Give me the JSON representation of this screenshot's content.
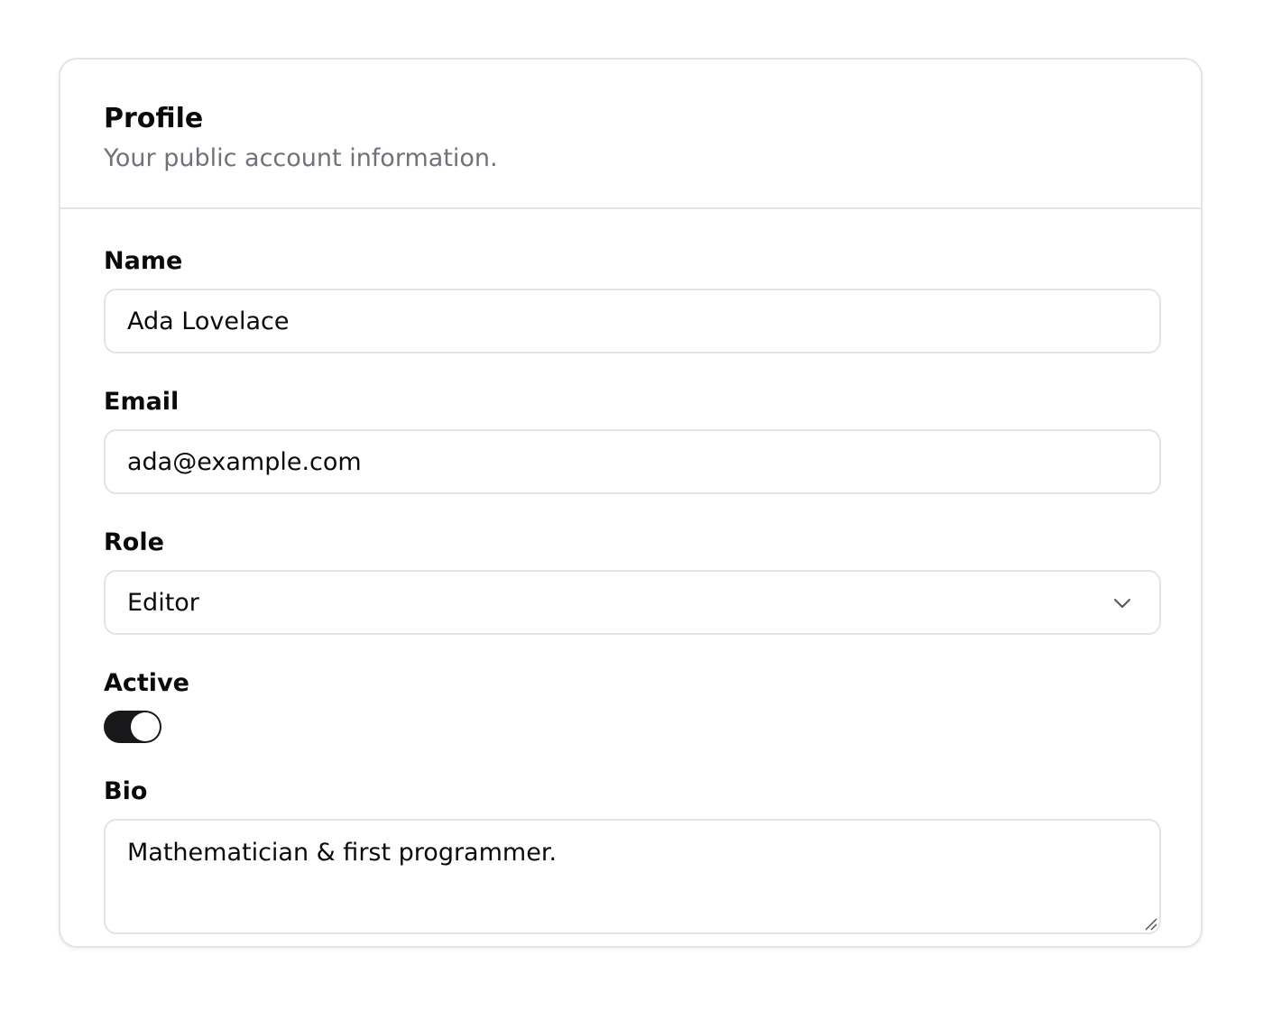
{
  "profile": {
    "title": "Profile",
    "subtitle": "Your public account information."
  },
  "fields": {
    "name": {
      "label": "Name",
      "value": "Ada Lovelace"
    },
    "email": {
      "label": "Email",
      "value": "ada@example.com"
    },
    "role": {
      "label": "Role",
      "value": "Editor",
      "icon": "chevron-down-icon"
    },
    "active": {
      "label": "Active",
      "state": "on"
    },
    "bio": {
      "label": "Bio",
      "value": "Mathematician & first programmer."
    }
  },
  "colors": {
    "border": "#e4e4e7",
    "toggle_on": "#18181b",
    "muted_text": "#71717a"
  }
}
